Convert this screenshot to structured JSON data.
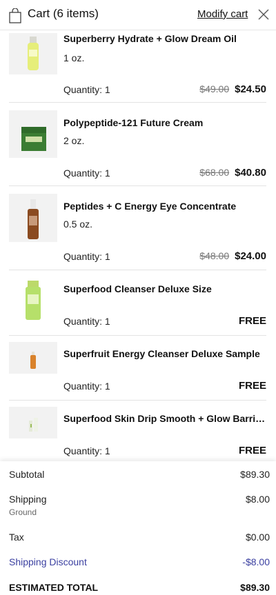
{
  "header": {
    "title": "Cart (6 items)",
    "modify_label": "Modify cart",
    "bag_icon": "shopping-bag-icon",
    "close_icon": "close-icon"
  },
  "items": [
    {
      "name": "Superberry Hydrate + Glow Dream Oil",
      "size": "1 oz.",
      "quantity": "Quantity: 1",
      "old_price": "$49.00",
      "price": "$24.50"
    },
    {
      "name": "Polypeptide-121 Future Cream",
      "size": "2 oz.",
      "quantity": "Quantity: 1",
      "old_price": "$68.00",
      "price": "$40.80"
    },
    {
      "name": "Peptides + C Energy Eye Concentrate",
      "size": "0.5 oz.",
      "quantity": "Quantity: 1",
      "old_price": "$48.00",
      "price": "$24.00"
    },
    {
      "name": "Superfood Cleanser Deluxe Size",
      "size": "",
      "quantity": "Quantity: 1",
      "old_price": "",
      "price": "FREE"
    },
    {
      "name": "Superfruit Energy Cleanser Deluxe Sample",
      "size": "",
      "quantity": "Quantity: 1",
      "old_price": "",
      "price": "FREE"
    },
    {
      "name": "Superfood Skin Drip Smooth + Glow Barrier Serum",
      "size": "",
      "quantity": "Quantity: 1",
      "old_price": "",
      "price": "FREE"
    }
  ],
  "summary": {
    "subtotal_label": "Subtotal",
    "subtotal_value": "$89.30",
    "shipping_label": "Shipping",
    "shipping_method": "Ground",
    "shipping_value": "$8.00",
    "tax_label": "Tax",
    "tax_value": "$0.00",
    "discount_label": "Shipping Discount",
    "discount_value": "-$8.00",
    "total_label": "ESTIMATED TOTAL",
    "total_value": "$89.30"
  },
  "colors": {
    "discount": "#3a3fa0",
    "divider": "#e3e3e3"
  }
}
